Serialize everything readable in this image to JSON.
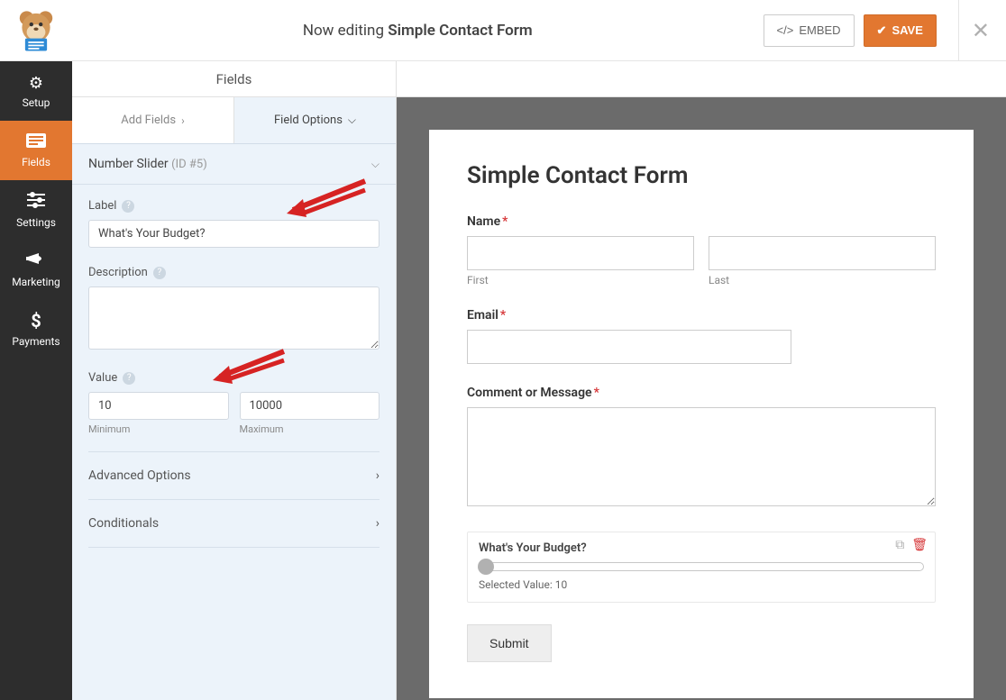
{
  "header": {
    "editing_prefix": "Now editing ",
    "form_name": "Simple Contact Form",
    "embed_label": "EMBED",
    "save_label": "SAVE"
  },
  "sidebar": {
    "items": [
      {
        "icon": "gear",
        "label": "Setup"
      },
      {
        "icon": "form",
        "label": "Fields"
      },
      {
        "icon": "sliders",
        "label": "Settings"
      },
      {
        "icon": "bullhorn",
        "label": "Marketing"
      },
      {
        "icon": "dollar",
        "label": "Payments"
      }
    ],
    "active_index": 1
  },
  "panel": {
    "top_title": "Fields",
    "tabs": {
      "add": "Add Fields",
      "options": "Field Options"
    },
    "field_header": {
      "name": "Number Slider",
      "id": "(ID #5)"
    },
    "label_section": {
      "label": "Label",
      "value": "What's Your Budget?"
    },
    "description_section": {
      "label": "Description",
      "value": ""
    },
    "value_section": {
      "label": "Value",
      "min_value": "10",
      "max_value": "10000",
      "min_label": "Minimum",
      "max_label": "Maximum"
    },
    "advanced": "Advanced Options",
    "conditionals": "Conditionals"
  },
  "preview": {
    "title": "Simple Contact Form",
    "name_label": "Name",
    "first": "First",
    "last": "Last",
    "email_label": "Email",
    "comment_label": "Comment or Message",
    "slider_label": "What's Your Budget?",
    "selected_value_prefix": "Selected Value: ",
    "selected_value": "10",
    "submit": "Submit"
  }
}
